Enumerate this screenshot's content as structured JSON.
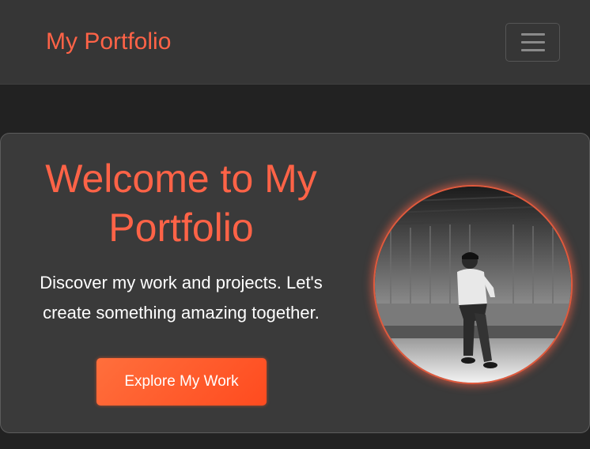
{
  "navbar": {
    "brand": "My Portfolio",
    "toggle_icon": "hamburger-menu-icon"
  },
  "hero": {
    "title": "Welcome to My Portfolio",
    "description": "Discover my work and projects. Let's create something amazing together.",
    "cta_label": "Explore My Work",
    "photo": "profile-photo"
  },
  "colors": {
    "accent": "#ff6347",
    "background": "#222222",
    "navbar": "#363636",
    "card": "#3a3a3a"
  }
}
